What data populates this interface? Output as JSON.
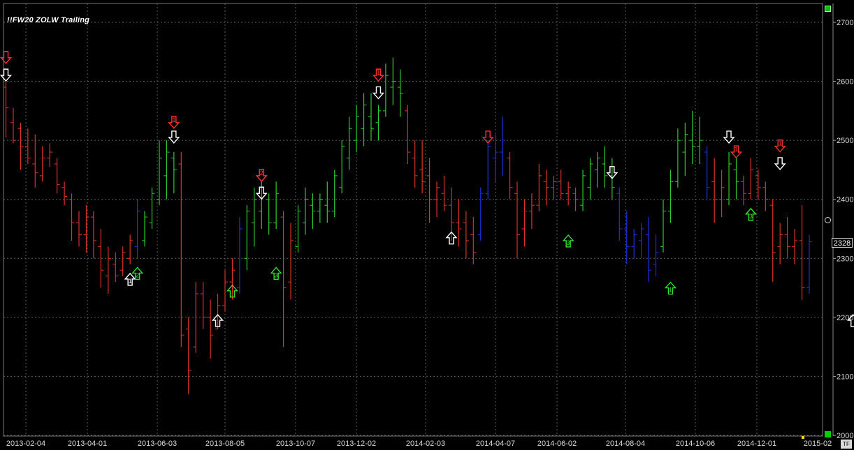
{
  "window": {
    "title": "!!FW20 ZOLW Trailing"
  },
  "colors": {
    "up": "#2ecc2e",
    "down": "#e0302a",
    "neutral": "#1f2fe0",
    "arrow_white": "#ffffff",
    "arrow_red": "#ff3030",
    "arrow_green": "#30e030",
    "grid": "#5a5a5a",
    "background": "#000000"
  },
  "last_price": "2328",
  "tf_label": "TF",
  "chart_data": {
    "type": "ohlc",
    "title": "!!FW20 ZOLW Trailing",
    "ylim": [
      2000,
      2720
    ],
    "y_ticks": [
      "2000",
      "2100",
      "2200",
      "2300",
      "2400",
      "2500",
      "2600",
      "2700"
    ],
    "x_ticks": [
      "2013-02-04",
      "2013-04-01",
      "2013-06-03",
      "2013-08-05",
      "2013-10-07",
      "2013-12-02",
      "2014-02-03",
      "2014-04-07",
      "2014-06-02",
      "2014-08-04",
      "2014-10-06",
      "2014-12-01",
      "2015-02"
    ],
    "grid": true,
    "bars": [
      {
        "i": 0,
        "c": "r",
        "h": 2600,
        "l": 2505,
        "o": 2590,
        "cl": 2555
      },
      {
        "i": 1,
        "c": "r",
        "h": 2555,
        "l": 2495,
        "o": 2530,
        "cl": 2500
      },
      {
        "i": 2,
        "c": "r",
        "h": 2530,
        "l": 2450,
        "o": 2520,
        "cl": 2490
      },
      {
        "i": 3,
        "c": "r",
        "h": 2520,
        "l": 2460,
        "o": 2490,
        "cl": 2470
      },
      {
        "i": 4,
        "c": "r",
        "h": 2510,
        "l": 2420,
        "o": 2460,
        "cl": 2445
      },
      {
        "i": 5,
        "c": "r",
        "h": 2490,
        "l": 2430,
        "o": 2440,
        "cl": 2470
      },
      {
        "i": 6,
        "c": "r",
        "h": 2495,
        "l": 2455,
        "o": 2470,
        "cl": 2480
      },
      {
        "i": 7,
        "c": "r",
        "h": 2470,
        "l": 2410,
        "o": 2460,
        "cl": 2425
      },
      {
        "i": 8,
        "c": "r",
        "h": 2430,
        "l": 2390,
        "o": 2420,
        "cl": 2405
      },
      {
        "i": 9,
        "c": "r",
        "h": 2410,
        "l": 2330,
        "o": 2400,
        "cl": 2360
      },
      {
        "i": 10,
        "c": "r",
        "h": 2380,
        "l": 2320,
        "o": 2360,
        "cl": 2340
      },
      {
        "i": 11,
        "c": "r",
        "h": 2390,
        "l": 2310,
        "o": 2340,
        "cl": 2370
      },
      {
        "i": 12,
        "c": "r",
        "h": 2380,
        "l": 2300,
        "o": 2370,
        "cl": 2330
      },
      {
        "i": 13,
        "c": "r",
        "h": 2350,
        "l": 2250,
        "o": 2320,
        "cl": 2280
      },
      {
        "i": 14,
        "c": "r",
        "h": 2320,
        "l": 2240,
        "o": 2270,
        "cl": 2300
      },
      {
        "i": 15,
        "c": "r",
        "h": 2310,
        "l": 2260,
        "o": 2290,
        "cl": 2270
      },
      {
        "i": 16,
        "c": "r",
        "h": 2320,
        "l": 2270,
        "o": 2280,
        "cl": 2310
      },
      {
        "i": 17,
        "c": "r",
        "h": 2340,
        "l": 2290,
        "o": 2300,
        "cl": 2330
      },
      {
        "i": 18,
        "c": "b",
        "h": 2400,
        "l": 2300,
        "o": 2320,
        "cl": 2380
      },
      {
        "i": 19,
        "c": "g",
        "h": 2380,
        "l": 2320,
        "o": 2330,
        "cl": 2370
      },
      {
        "i": 20,
        "c": "g",
        "h": 2420,
        "l": 2350,
        "o": 2360,
        "cl": 2410
      },
      {
        "i": 21,
        "c": "g",
        "h": 2500,
        "l": 2390,
        "o": 2400,
        "cl": 2470
      },
      {
        "i": 22,
        "c": "g",
        "h": 2500,
        "l": 2400,
        "o": 2440,
        "cl": 2480
      },
      {
        "i": 23,
        "c": "g",
        "h": 2480,
        "l": 2410,
        "o": 2470,
        "cl": 2450
      },
      {
        "i": 24,
        "c": "r",
        "h": 2480,
        "l": 2150,
        "o": 2460,
        "cl": 2170
      },
      {
        "i": 25,
        "c": "r",
        "h": 2200,
        "l": 2070,
        "o": 2180,
        "cl": 2110
      },
      {
        "i": 26,
        "c": "r",
        "h": 2260,
        "l": 2140,
        "o": 2150,
        "cl": 2240
      },
      {
        "i": 27,
        "c": "r",
        "h": 2260,
        "l": 2180,
        "o": 2240,
        "cl": 2200
      },
      {
        "i": 28,
        "c": "r",
        "h": 2230,
        "l": 2130,
        "o": 2200,
        "cl": 2170
      },
      {
        "i": 29,
        "c": "r",
        "h": 2240,
        "l": 2180,
        "o": 2180,
        "cl": 2220
      },
      {
        "i": 30,
        "c": "r",
        "h": 2280,
        "l": 2210,
        "o": 2220,
        "cl": 2260
      },
      {
        "i": 31,
        "c": "r",
        "h": 2300,
        "l": 2230,
        "o": 2260,
        "cl": 2280
      },
      {
        "i": 32,
        "c": "b",
        "h": 2370,
        "l": 2240,
        "o": 2250,
        "cl": 2350
      },
      {
        "i": 33,
        "c": "g",
        "h": 2390,
        "l": 2280,
        "o": 2300,
        "cl": 2380
      },
      {
        "i": 34,
        "c": "g",
        "h": 2420,
        "l": 2320,
        "o": 2360,
        "cl": 2400
      },
      {
        "i": 35,
        "c": "g",
        "h": 2430,
        "l": 2350,
        "o": 2380,
        "cl": 2420
      },
      {
        "i": 36,
        "c": "g",
        "h": 2410,
        "l": 2340,
        "o": 2400,
        "cl": 2360
      },
      {
        "i": 37,
        "c": "g",
        "h": 2430,
        "l": 2350,
        "o": 2360,
        "cl": 2410
      },
      {
        "i": 38,
        "c": "r",
        "h": 2380,
        "l": 2150,
        "o": 2370,
        "cl": 2250
      },
      {
        "i": 39,
        "c": "r",
        "h": 2360,
        "l": 2230,
        "o": 2260,
        "cl": 2330
      },
      {
        "i": 40,
        "c": "g",
        "h": 2390,
        "l": 2310,
        "o": 2320,
        "cl": 2380
      },
      {
        "i": 41,
        "c": "g",
        "h": 2420,
        "l": 2340,
        "o": 2360,
        "cl": 2400
      },
      {
        "i": 42,
        "c": "g",
        "h": 2410,
        "l": 2350,
        "o": 2390,
        "cl": 2380
      },
      {
        "i": 43,
        "c": "g",
        "h": 2410,
        "l": 2360,
        "o": 2380,
        "cl": 2400
      },
      {
        "i": 44,
        "c": "g",
        "h": 2430,
        "l": 2360,
        "o": 2390,
        "cl": 2380
      },
      {
        "i": 45,
        "c": "g",
        "h": 2450,
        "l": 2370,
        "o": 2380,
        "cl": 2440
      },
      {
        "i": 46,
        "c": "g",
        "h": 2500,
        "l": 2410,
        "o": 2420,
        "cl": 2490
      },
      {
        "i": 47,
        "c": "g",
        "h": 2540,
        "l": 2450,
        "o": 2470,
        "cl": 2520
      },
      {
        "i": 48,
        "c": "g",
        "h": 2560,
        "l": 2480,
        "o": 2500,
        "cl": 2540
      },
      {
        "i": 49,
        "c": "g",
        "h": 2580,
        "l": 2490,
        "o": 2520,
        "cl": 2560
      },
      {
        "i": 50,
        "c": "g",
        "h": 2580,
        "l": 2500,
        "o": 2540,
        "cl": 2520
      },
      {
        "i": 51,
        "c": "g",
        "h": 2560,
        "l": 2500,
        "o": 2530,
        "cl": 2550
      },
      {
        "i": 52,
        "c": "g",
        "h": 2630,
        "l": 2540,
        "o": 2550,
        "cl": 2610
      },
      {
        "i": 53,
        "c": "g",
        "h": 2640,
        "l": 2560,
        "o": 2590,
        "cl": 2600
      },
      {
        "i": 54,
        "c": "g",
        "h": 2620,
        "l": 2540,
        "o": 2590,
        "cl": 2580
      },
      {
        "i": 55,
        "c": "r",
        "h": 2560,
        "l": 2460,
        "o": 2550,
        "cl": 2480
      },
      {
        "i": 56,
        "c": "r",
        "h": 2500,
        "l": 2420,
        "o": 2470,
        "cl": 2440
      },
      {
        "i": 57,
        "c": "r",
        "h": 2500,
        "l": 2410,
        "o": 2450,
        "cl": 2430
      },
      {
        "i": 58,
        "c": "r",
        "h": 2470,
        "l": 2360,
        "o": 2440,
        "cl": 2400
      },
      {
        "i": 59,
        "c": "r",
        "h": 2430,
        "l": 2370,
        "o": 2400,
        "cl": 2420
      },
      {
        "i": 60,
        "c": "r",
        "h": 2440,
        "l": 2380,
        "o": 2410,
        "cl": 2390
      },
      {
        "i": 61,
        "c": "r",
        "h": 2420,
        "l": 2330,
        "o": 2390,
        "cl": 2360
      },
      {
        "i": 62,
        "c": "r",
        "h": 2400,
        "l": 2320,
        "o": 2360,
        "cl": 2350
      },
      {
        "i": 63,
        "c": "r",
        "h": 2380,
        "l": 2300,
        "o": 2360,
        "cl": 2330
      },
      {
        "i": 64,
        "c": "r",
        "h": 2370,
        "l": 2290,
        "o": 2340,
        "cl": 2310
      },
      {
        "i": 65,
        "c": "b",
        "h": 2420,
        "l": 2330,
        "o": 2340,
        "cl": 2410
      },
      {
        "i": 66,
        "c": "b",
        "h": 2500,
        "l": 2400,
        "o": 2410,
        "cl": 2490
      },
      {
        "i": 67,
        "c": "b",
        "h": 2510,
        "l": 2430,
        "o": 2470,
        "cl": 2480
      },
      {
        "i": 68,
        "c": "b",
        "h": 2540,
        "l": 2440,
        "o": 2480,
        "cl": 2500
      },
      {
        "i": 69,
        "c": "r",
        "h": 2480,
        "l": 2400,
        "o": 2470,
        "cl": 2420
      },
      {
        "i": 70,
        "c": "r",
        "h": 2430,
        "l": 2300,
        "o": 2410,
        "cl": 2340
      },
      {
        "i": 71,
        "c": "r",
        "h": 2400,
        "l": 2320,
        "o": 2350,
        "cl": 2380
      },
      {
        "i": 72,
        "c": "r",
        "h": 2410,
        "l": 2350,
        "o": 2380,
        "cl": 2390
      },
      {
        "i": 73,
        "c": "r",
        "h": 2460,
        "l": 2380,
        "o": 2390,
        "cl": 2440
      },
      {
        "i": 74,
        "c": "r",
        "h": 2450,
        "l": 2390,
        "o": 2430,
        "cl": 2420
      },
      {
        "i": 75,
        "c": "r",
        "h": 2440,
        "l": 2400,
        "o": 2420,
        "cl": 2430
      },
      {
        "i": 76,
        "c": "r",
        "h": 2450,
        "l": 2400,
        "o": 2430,
        "cl": 2410
      },
      {
        "i": 77,
        "c": "r",
        "h": 2430,
        "l": 2390,
        "o": 2410,
        "cl": 2420
      },
      {
        "i": 78,
        "c": "r",
        "h": 2420,
        "l": 2380,
        "o": 2410,
        "cl": 2400
      },
      {
        "i": 79,
        "c": "g",
        "h": 2450,
        "l": 2380,
        "o": 2390,
        "cl": 2440
      },
      {
        "i": 80,
        "c": "g",
        "h": 2470,
        "l": 2400,
        "o": 2420,
        "cl": 2460
      },
      {
        "i": 81,
        "c": "g",
        "h": 2480,
        "l": 2420,
        "o": 2450,
        "cl": 2470
      },
      {
        "i": 82,
        "c": "g",
        "h": 2490,
        "l": 2420,
        "o": 2460,
        "cl": 2440
      },
      {
        "i": 83,
        "c": "g",
        "h": 2470,
        "l": 2400,
        "o": 2440,
        "cl": 2420
      },
      {
        "i": 84,
        "c": "b",
        "h": 2420,
        "l": 2330,
        "o": 2410,
        "cl": 2350
      },
      {
        "i": 85,
        "c": "b",
        "h": 2380,
        "l": 2290,
        "o": 2350,
        "cl": 2320
      },
      {
        "i": 86,
        "c": "b",
        "h": 2350,
        "l": 2300,
        "o": 2320,
        "cl": 2340
      },
      {
        "i": 87,
        "c": "b",
        "h": 2360,
        "l": 2300,
        "o": 2330,
        "cl": 2350
      },
      {
        "i": 88,
        "c": "b",
        "h": 2370,
        "l": 2260,
        "o": 2340,
        "cl": 2280
      },
      {
        "i": 89,
        "c": "b",
        "h": 2340,
        "l": 2270,
        "o": 2290,
        "cl": 2310
      },
      {
        "i": 90,
        "c": "g",
        "h": 2400,
        "l": 2310,
        "o": 2320,
        "cl": 2380
      },
      {
        "i": 91,
        "c": "g",
        "h": 2450,
        "l": 2360,
        "o": 2380,
        "cl": 2430
      },
      {
        "i": 92,
        "c": "g",
        "h": 2520,
        "l": 2420,
        "o": 2430,
        "cl": 2500
      },
      {
        "i": 93,
        "c": "g",
        "h": 2530,
        "l": 2440,
        "o": 2480,
        "cl": 2510
      },
      {
        "i": 94,
        "c": "g",
        "h": 2550,
        "l": 2460,
        "o": 2500,
        "cl": 2490
      },
      {
        "i": 95,
        "c": "g",
        "h": 2540,
        "l": 2460,
        "o": 2490,
        "cl": 2500
      },
      {
        "i": 96,
        "c": "b",
        "h": 2490,
        "l": 2400,
        "o": 2480,
        "cl": 2420
      },
      {
        "i": 97,
        "c": "r",
        "h": 2470,
        "l": 2360,
        "o": 2430,
        "cl": 2400
      },
      {
        "i": 98,
        "c": "r",
        "h": 2450,
        "l": 2370,
        "o": 2400,
        "cl": 2420
      },
      {
        "i": 99,
        "c": "g",
        "h": 2480,
        "l": 2390,
        "o": 2400,
        "cl": 2460
      },
      {
        "i": 100,
        "c": "g",
        "h": 2470,
        "l": 2400,
        "o": 2450,
        "cl": 2430
      },
      {
        "i": 101,
        "c": "r",
        "h": 2440,
        "l": 2390,
        "o": 2430,
        "cl": 2410
      },
      {
        "i": 102,
        "c": "r",
        "h": 2470,
        "l": 2400,
        "o": 2410,
        "cl": 2450
      },
      {
        "i": 103,
        "c": "r",
        "h": 2450,
        "l": 2400,
        "o": 2440,
        "cl": 2420
      },
      {
        "i": 104,
        "c": "r",
        "h": 2430,
        "l": 2380,
        "o": 2420,
        "cl": 2400
      },
      {
        "i": 105,
        "c": "r",
        "h": 2400,
        "l": 2260,
        "o": 2390,
        "cl": 2310
      },
      {
        "i": 106,
        "c": "r",
        "h": 2360,
        "l": 2290,
        "o": 2320,
        "cl": 2340
      },
      {
        "i": 107,
        "c": "r",
        "h": 2370,
        "l": 2300,
        "o": 2340,
        "cl": 2320
      },
      {
        "i": 108,
        "c": "r",
        "h": 2350,
        "l": 2290,
        "o": 2320,
        "cl": 2330
      },
      {
        "i": 109,
        "c": "r",
        "h": 2390,
        "l": 2230,
        "o": 2330,
        "cl": 2250
      },
      {
        "i": 110,
        "c": "b",
        "h": 2340,
        "l": 2240,
        "o": 2250,
        "cl": 2328
      }
    ],
    "arrows": [
      {
        "kind": "down",
        "color": "red",
        "label": "",
        "i": 0,
        "price": 2640
      },
      {
        "kind": "down",
        "color": "white",
        "label": "",
        "i": 0,
        "price": 2610
      },
      {
        "kind": "down",
        "color": "red",
        "label": "1",
        "i": 23,
        "price": 2530
      },
      {
        "kind": "down",
        "color": "white",
        "label": "",
        "i": 23,
        "price": 2505
      },
      {
        "kind": "up",
        "color": "white",
        "label": "1",
        "i": 17,
        "price": 2265
      },
      {
        "kind": "up",
        "color": "green",
        "label": "2",
        "i": 18,
        "price": 2275
      },
      {
        "kind": "down",
        "color": "red",
        "label": "2",
        "i": 35,
        "price": 2440
      },
      {
        "kind": "down",
        "color": "white",
        "label": "",
        "i": 35,
        "price": 2410
      },
      {
        "kind": "up",
        "color": "white",
        "label": "",
        "i": 29,
        "price": 2195
      },
      {
        "kind": "up",
        "color": "green",
        "label": "",
        "i": 31,
        "price": 2245
      },
      {
        "kind": "up",
        "color": "green",
        "label": "3",
        "i": 37,
        "price": 2275
      },
      {
        "kind": "down",
        "color": "red",
        "label": "1",
        "i": 51,
        "price": 2610
      },
      {
        "kind": "down",
        "color": "white",
        "label": "",
        "i": 51,
        "price": 2580
      },
      {
        "kind": "up",
        "color": "white",
        "label": "",
        "i": 61,
        "price": 2335
      },
      {
        "kind": "down",
        "color": "red",
        "label": "",
        "i": 66,
        "price": 2505
      },
      {
        "kind": "up",
        "color": "green",
        "label": "3",
        "i": 77,
        "price": 2330
      },
      {
        "kind": "down",
        "color": "white",
        "label": "",
        "i": 83,
        "price": 2445
      },
      {
        "kind": "up",
        "color": "green",
        "label": "1",
        "i": 91,
        "price": 2250
      },
      {
        "kind": "down",
        "color": "white",
        "label": "",
        "i": 99,
        "price": 2505
      },
      {
        "kind": "down",
        "color": "red",
        "label": "1",
        "i": 100,
        "price": 2480
      },
      {
        "kind": "down",
        "color": "red",
        "label": "1",
        "i": 106,
        "price": 2490
      },
      {
        "kind": "down",
        "color": "white",
        "label": "",
        "i": 106,
        "price": 2460
      },
      {
        "kind": "up",
        "color": "green",
        "label": "3",
        "i": 102,
        "price": 2375
      },
      {
        "kind": "up",
        "color": "white",
        "label": "",
        "i": 116,
        "price": 2195
      }
    ]
  }
}
